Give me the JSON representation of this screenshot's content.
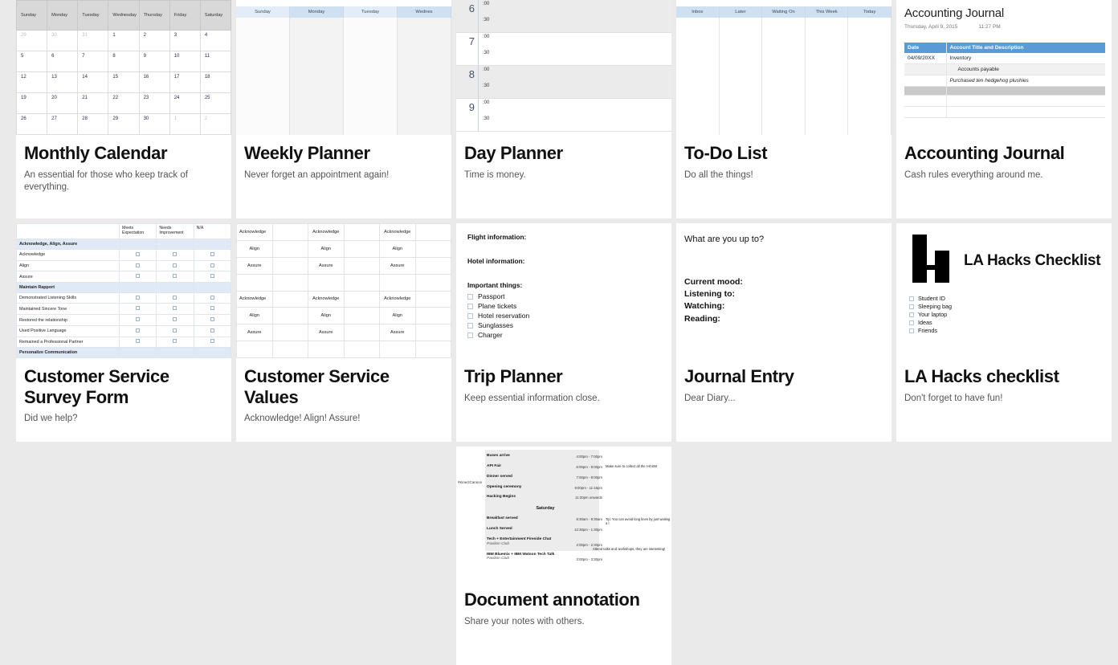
{
  "page": {
    "background": "#eaeaea",
    "card_background": "#ffffff"
  },
  "cards": [
    {
      "title": "Monthly Calendar",
      "subtitle": "An essential for those who keep track of everything.",
      "preview": {
        "type": "month-grid",
        "weekdays": [
          "Sunday",
          "Monday",
          "Tuesday",
          "Wednesday",
          "Thursday",
          "Friday",
          "Saturday"
        ],
        "weeks": [
          [
            "29",
            "30",
            "31",
            "1",
            "2",
            "3",
            "4"
          ],
          [
            "5",
            "6",
            "7",
            "8",
            "9",
            "10",
            "11"
          ],
          [
            "12",
            "13",
            "14",
            "15",
            "16",
            "17",
            "18"
          ],
          [
            "19",
            "20",
            "21",
            "22",
            "23",
            "24",
            "25"
          ],
          [
            "26",
            "27",
            "28",
            "29",
            "30",
            "1",
            "2"
          ]
        ],
        "dim_cells": [
          "0-0",
          "0-1",
          "0-2",
          "4-5",
          "4-6"
        ]
      }
    },
    {
      "title": "Weekly Planner",
      "subtitle": "Never forget an appointment again!",
      "preview": {
        "type": "week-columns",
        "columns": [
          "Sunday",
          "Monday",
          "Tuesday",
          "Wednes"
        ]
      }
    },
    {
      "title": "Day Planner",
      "subtitle": "Time is money.",
      "preview": {
        "type": "day-hours",
        "hours": [
          "6",
          "7",
          "8",
          "9"
        ],
        "slots": [
          ":00",
          ":30"
        ]
      }
    },
    {
      "title": "To-Do List",
      "subtitle": "Do all the things!",
      "preview": {
        "type": "kanban-columns",
        "columns": [
          "Inbox",
          "Later",
          "Waiting On",
          "This Week",
          "Today"
        ]
      }
    },
    {
      "title": "Accounting Journal",
      "subtitle": "Cash rules everything around me.",
      "preview": {
        "type": "journal",
        "doc_title": "Accounting Journal",
        "date": "Thursday, April 9, 2015",
        "time": "11:27 PM",
        "header_color": "#5b9bd5",
        "columns": [
          "Date",
          "Account Title and Description"
        ],
        "rows": [
          {
            "date": "04/09/20XX",
            "desc": "Inventory",
            "style": "plain"
          },
          {
            "date": "",
            "desc": "Accounts payable",
            "style": "indent"
          },
          {
            "date": "",
            "desc": "Purchased ten hedgehog plushies",
            "style": "italic"
          },
          {
            "date": "",
            "desc": "",
            "style": "gray"
          },
          {
            "date": "",
            "desc": "",
            "style": "plain"
          },
          {
            "date": "",
            "desc": "",
            "style": "plain"
          }
        ]
      }
    },
    {
      "title": "Customer Service Survey Form",
      "subtitle": "Did we help?",
      "preview": {
        "type": "survey",
        "columns": [
          "Meets Expectation",
          "Needs Improvement",
          "N/A"
        ],
        "rows": [
          {
            "label": "Acknowledge, Align, Assure",
            "section": true
          },
          {
            "label": "Acknowledge",
            "section": false
          },
          {
            "label": "Align",
            "section": false
          },
          {
            "label": "Assure",
            "section": false
          },
          {
            "label": "Maintain Rapport",
            "section": true
          },
          {
            "label": "Demonstrated Listening Skills",
            "section": false
          },
          {
            "label": "Maintained Sincere Tone",
            "section": false
          },
          {
            "label": "Restored the relationship",
            "section": false
          },
          {
            "label": "Used Positive Language",
            "section": false
          },
          {
            "label": "Remained a Professional Partner",
            "section": false
          },
          {
            "label": "Personalize Communication",
            "section": true
          }
        ]
      }
    },
    {
      "title": "Customer Service Values",
      "subtitle": "Acknowledge! Align! Assure!",
      "preview": {
        "type": "values-grid",
        "values": [
          "Acknowledge",
          "Align",
          "Assure"
        ]
      }
    },
    {
      "title": "Trip Planner",
      "subtitle": "Keep essential information close.",
      "preview": {
        "type": "trip",
        "headings": [
          "Flight information:",
          "Hotel information:",
          "Important things:"
        ],
        "checklist": [
          "Passport",
          "Plane tickets",
          "Hotel reservation",
          "Sunglasses",
          "Charger"
        ]
      }
    },
    {
      "title": "Journal Entry",
      "subtitle": "Dear Diary...",
      "preview": {
        "type": "journal-entry",
        "question": "What are you up to?",
        "fields": [
          "Current mood:",
          "Listening to:",
          "Watching:",
          "Reading:"
        ]
      }
    },
    {
      "title": "LA Hacks checklist",
      "subtitle": "Don't forget to have fun!",
      "preview": {
        "type": "la-hacks",
        "logo": "lh-monogram-icon",
        "heading": "LA Hacks Checklist",
        "checklist": [
          "Student ID",
          "Sleeping bag",
          "Your laptop",
          "Ideas",
          "Friends"
        ]
      }
    },
    {
      "title": "Document annotation",
      "subtitle": "Share your notes with others.",
      "preview": {
        "type": "annotated-schedule",
        "tag": "#KinectCannon",
        "day_label": "Saturday",
        "rows": [
          {
            "name": "Buses arrive",
            "time": "4:00pm - 7:00pm",
            "location": ""
          },
          {
            "name": "API Fair",
            "time": "6:00pm - 9:00pm",
            "location": ""
          },
          {
            "name": "Dinner served",
            "time": "7:00pm - 8:00pm",
            "location": ""
          },
          {
            "name": "Opening ceremony",
            "time": "9:00pm - 11:15pm",
            "location": ""
          },
          {
            "name": "Hacking Begins",
            "time": "11:30pm onwards",
            "location": ""
          },
          {
            "name": "Breakfast served",
            "time": "8:30am - 9:30am",
            "location": ""
          },
          {
            "name": "Lunch Served",
            "time": "12:30pm - 1:30pm",
            "location": ""
          },
          {
            "name": "Tech + Entertainment Fireside Chat",
            "time": "2:00pm - 2:30pm",
            "location": "Pavilion Club"
          },
          {
            "name": "IBM Bluemix + IBM Watson Tech Talk",
            "time": "3:00pm - 3:30pm",
            "location": "Pavilion Club"
          }
        ],
        "notes": [
          "Make sure to collect all the t-shirts!",
          "Tip: You can avoid long lines by just waiting a l",
          "Attend talks and workshops, they are interesting!"
        ]
      }
    }
  ]
}
